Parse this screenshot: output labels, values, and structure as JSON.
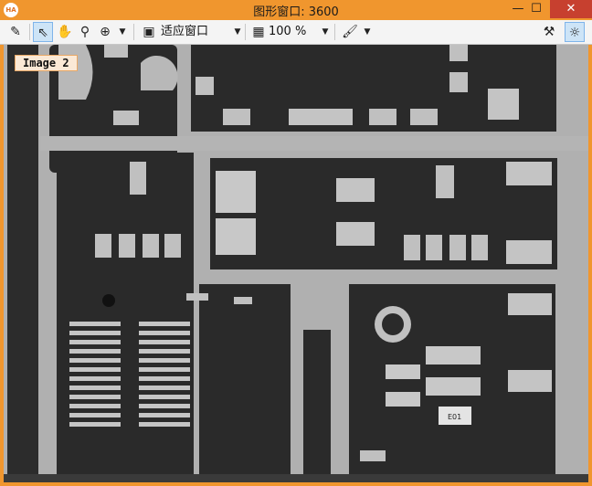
{
  "window": {
    "title": "图形窗口: 3600",
    "app_icon": "HA"
  },
  "controls": {
    "minimize": "—",
    "maximize": "☐",
    "close": "✕"
  },
  "toolbar": {
    "zoom_mode": "适应窗口",
    "zoom_percent": "100 %",
    "arrow": "▼"
  },
  "viewer": {
    "image_label": "Image 2",
    "chip_marking": "E01"
  },
  "colors": {
    "frame": "#f0962e",
    "pcb_dark": "#2b2b2b",
    "pcb_trace": "#b8b8b8",
    "label_bg": "#fbe9d6"
  }
}
